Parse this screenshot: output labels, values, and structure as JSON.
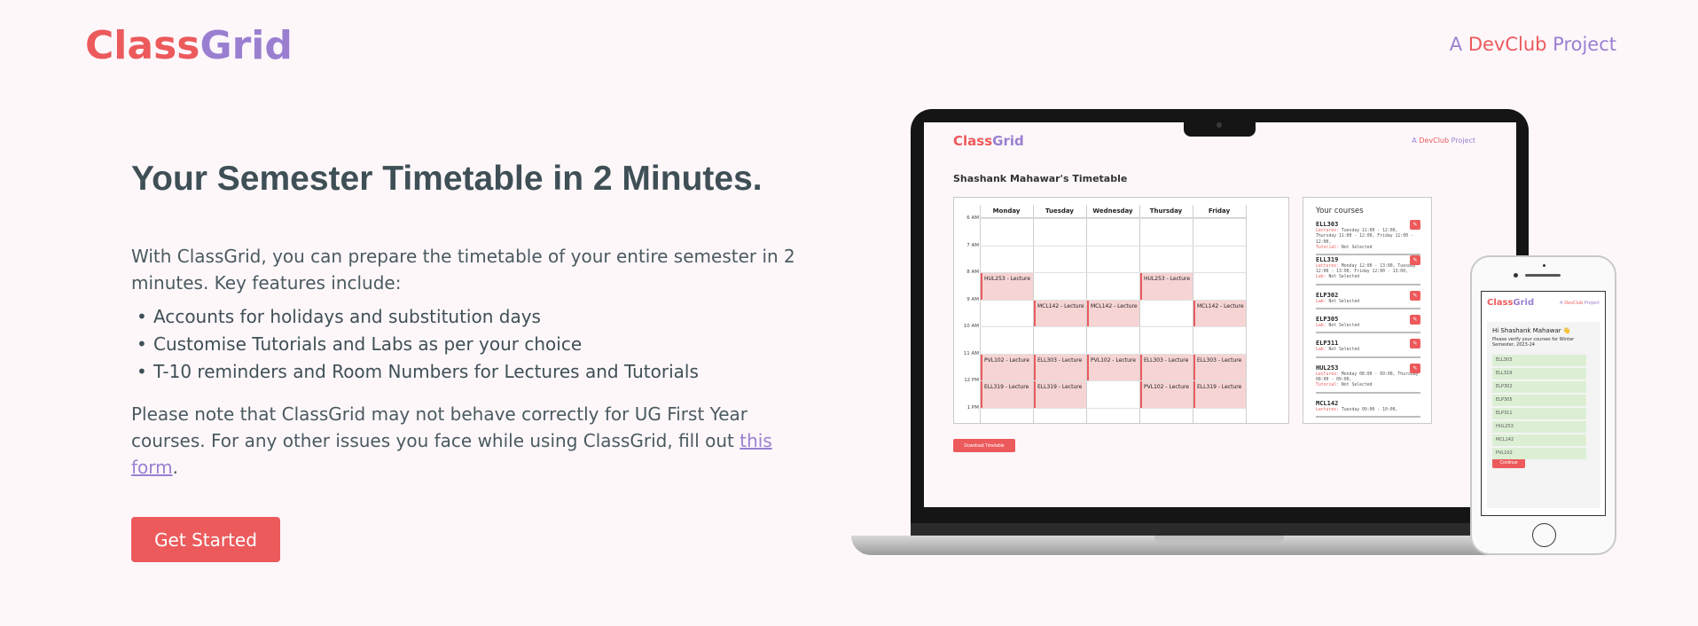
{
  "header": {
    "logo_part1": "Class",
    "logo_part2": "Grid",
    "tagline_a": "A ",
    "tagline_devclub": "DevClub",
    "tagline_project": " Project"
  },
  "hero": {
    "title": "Your Semester Timetable in 2 Minutes.",
    "intro": "With ClassGrid, you can prepare the timetable of your entire semester in 2 minutes. Key features include:",
    "features": [
      "Accounts for holidays and substitution days",
      "Customise Tutorials and Labs as per your choice",
      "T-10 reminders and Room Numbers for Lectures and Tutorials"
    ],
    "note_before_link": "Please note that ClassGrid may not behave correctly for UG First Year courses. For any other issues you face while using ClassGrid, fill out ",
    "note_link": "this form",
    "note_after_link": ".",
    "cta_label": "Get Started"
  },
  "laptop_screen": {
    "logo_part1": "Class",
    "logo_part2": "Grid",
    "tagline_a": "A ",
    "tagline_devclub": "DevClub",
    "tagline_project": " Project",
    "timetable_title": "Shashank Mahawar's Timetable",
    "days": [
      "Monday",
      "Tuesday",
      "Wednesday",
      "Thursday",
      "Friday"
    ],
    "times": [
      "6 AM",
      "7 AM",
      "8 AM",
      "9 AM",
      "10 AM",
      "11 AM",
      "12 PM",
      "1 PM"
    ],
    "slots": [
      {
        "day": 0,
        "row": 2,
        "label": "HUL253 - Lecture"
      },
      {
        "day": 3,
        "row": 2,
        "label": "HUL253 - Lecture"
      },
      {
        "day": 1,
        "row": 3,
        "label": "MCL142 - Lecture"
      },
      {
        "day": 2,
        "row": 3,
        "label": "MCL142 - Lecture"
      },
      {
        "day": 4,
        "row": 3,
        "label": "MCL142 - Lecture"
      },
      {
        "day": 0,
        "row": 5,
        "label": "PVL102 - Lecture"
      },
      {
        "day": 1,
        "row": 5,
        "label": "ELL303 - Lecture"
      },
      {
        "day": 2,
        "row": 5,
        "label": "PVL102 - Lecture"
      },
      {
        "day": 3,
        "row": 5,
        "label": "ELL303 - Lecture"
      },
      {
        "day": 4,
        "row": 5,
        "label": "ELL303 - Lecture"
      },
      {
        "day": 0,
        "row": 6,
        "label": "ELL319 - Lecture"
      },
      {
        "day": 1,
        "row": 6,
        "label": "ELL319 - Lecture"
      },
      {
        "day": 3,
        "row": 6,
        "label": "PVL102 - Lecture"
      },
      {
        "day": 4,
        "row": 6,
        "label": "ELL319 - Lecture"
      }
    ],
    "courses_heading": "Your courses",
    "courses": [
      {
        "code": "ELL303",
        "lines": [
          [
            "Lectures:",
            " Tuesday 11:00 - 12:00, Thursday 11:00 - 12:00, Friday 11:00 - 12:00,"
          ],
          [
            "Tutorial:",
            " Not Selected"
          ]
        ]
      },
      {
        "code": "ELL319",
        "lines": [
          [
            "Lectures:",
            " Monday 12:00 - 13:00, Tuesday 12:00 - 13:00, Friday 12:00 - 13:00,"
          ],
          [
            "Lab:",
            " Not Selected"
          ]
        ]
      },
      {
        "code": "ELP302",
        "lines": [
          [
            "Lab:",
            " Not Selected"
          ]
        ]
      },
      {
        "code": "ELP305",
        "lines": [
          [
            "Lab:",
            " Not Selected"
          ]
        ]
      },
      {
        "code": "ELP311",
        "lines": [
          [
            "Lab:",
            " Not Selected"
          ]
        ]
      },
      {
        "code": "HUL253",
        "lines": [
          [
            "Lectures:",
            " Monday 08:00 - 09:00, Thursday 08:00 - 09:00,"
          ],
          [
            "Tutorial:",
            " Not Selected"
          ]
        ]
      },
      {
        "code": "MCL142",
        "lines": [
          [
            "Lectures:",
            " Tuesday 09:00 - 10:00,"
          ]
        ]
      }
    ],
    "delete_glyph": "✎",
    "download_label": "Download Timetable"
  },
  "phone_screen": {
    "logo_part1": "Class",
    "logo_part2": "Grid",
    "tagline_a": "A ",
    "tagline_devclub": "DevClub",
    "tagline_project": " Project",
    "greeting": "Hi Shashank Mahawar 👋",
    "subtitle": "Please verify your courses for Winter Semester, 2023-24",
    "courses": [
      "ELL303",
      "ELL319",
      "ELP302",
      "ELP305",
      "ELP311",
      "HUL253",
      "MCL142",
      "PVL102"
    ],
    "continue_label": "Continue"
  },
  "colors": {
    "accent_red": "#ec5a5c",
    "accent_purple": "#9a7fd1",
    "background": "#fdf7fa",
    "text_dark": "#3f4f56"
  }
}
